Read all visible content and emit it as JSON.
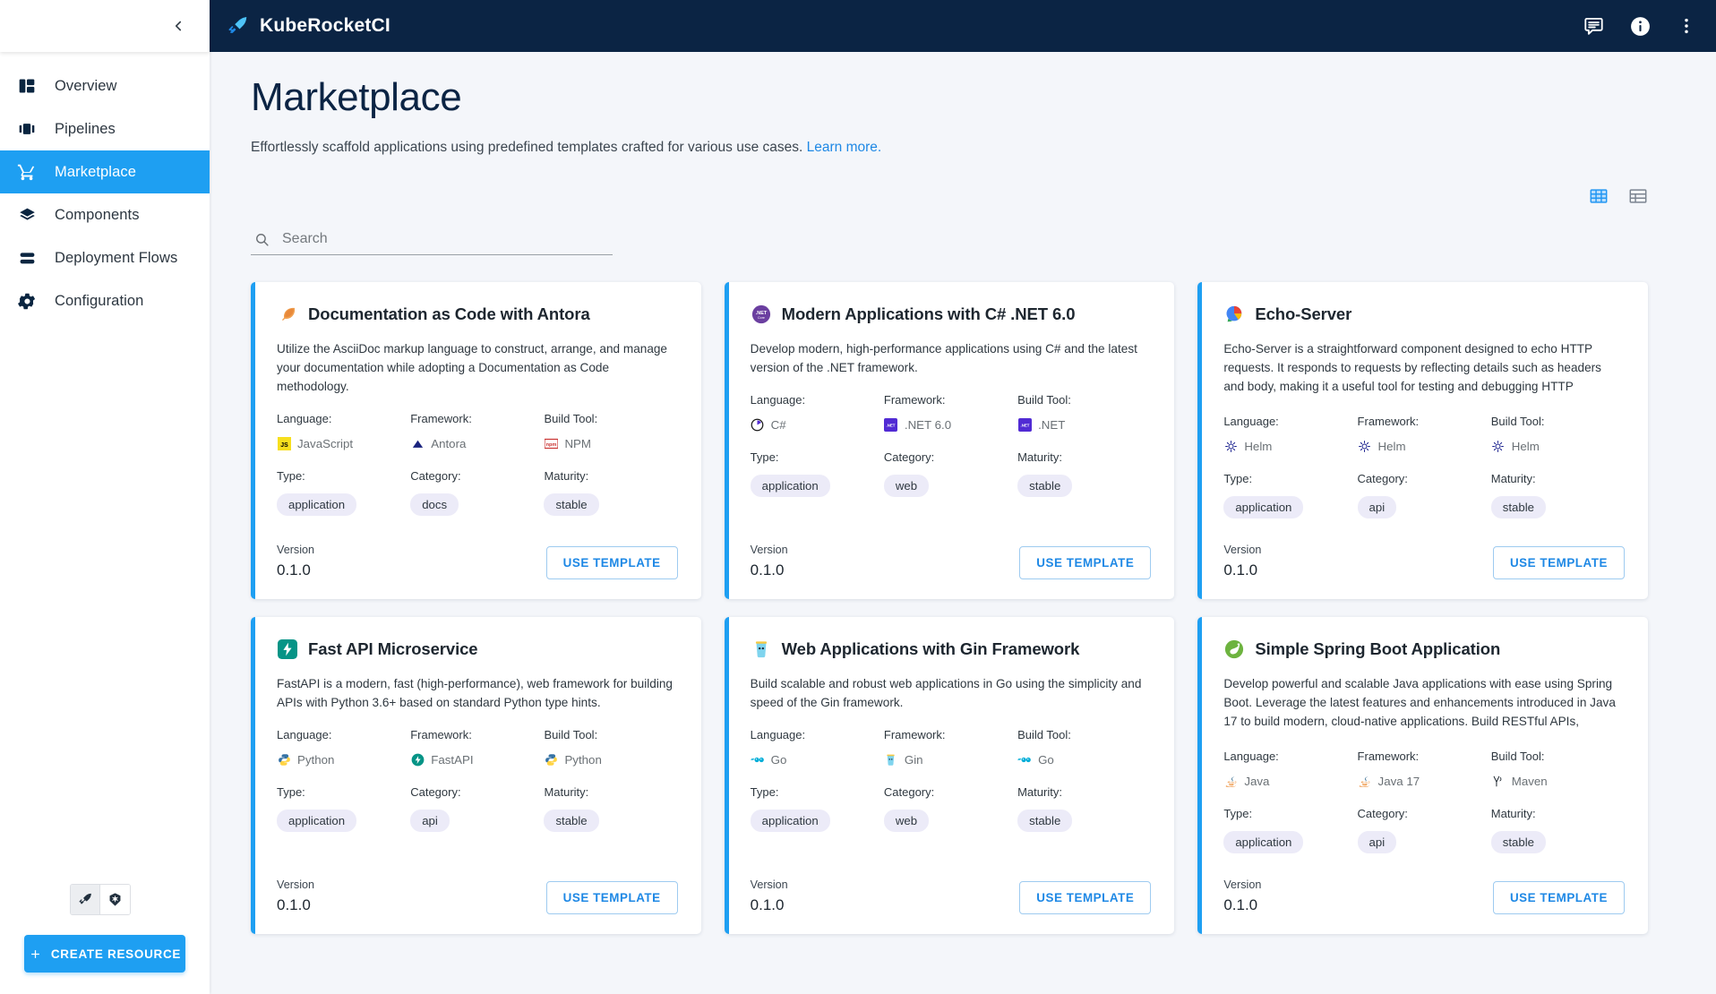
{
  "topbar": {
    "brand_name": "KubeRocketCI",
    "icons": [
      {
        "name": "chat-icon",
        "label": "Chat"
      },
      {
        "name": "info-icon",
        "label": "Info"
      },
      {
        "name": "kebab-menu-icon",
        "label": "More"
      }
    ]
  },
  "sidebar": {
    "collapse_label": "Collapse",
    "items": [
      {
        "label": "Overview",
        "icon": "dashboard-icon",
        "active": false
      },
      {
        "label": "Pipelines",
        "icon": "pipelines-icon",
        "active": false
      },
      {
        "label": "Marketplace",
        "icon": "cart-icon",
        "active": true
      },
      {
        "label": "Components",
        "icon": "layers-icon",
        "active": false
      },
      {
        "label": "Deployment Flows",
        "icon": "stack-icon",
        "active": false
      },
      {
        "label": "Configuration",
        "icon": "gear-icon",
        "active": false
      }
    ],
    "mode_toggle": [
      {
        "name": "kuberocket-mode-icon",
        "active": true
      },
      {
        "name": "kubernetes-mode-icon",
        "active": false
      }
    ],
    "create_button": "CREATE RESOURCE"
  },
  "page": {
    "title": "Marketplace",
    "subtitle": "Effortlessly scaffold applications using predefined templates crafted for various use cases.",
    "learn_more": "Learn more."
  },
  "view_toggle": [
    {
      "name": "grid-view-icon",
      "active": true
    },
    {
      "name": "table-view-icon",
      "active": false
    }
  ],
  "search": {
    "placeholder": "Search",
    "value": ""
  },
  "labels": {
    "language": "Language:",
    "framework": "Framework:",
    "build_tool": "Build Tool:",
    "type": "Type:",
    "category": "Category:",
    "maturity": "Maturity:",
    "version": "Version",
    "use_template": "USE TEMPLATE"
  },
  "colors": {
    "accent": "#1e9ff2",
    "topbar": "#0b2444",
    "chip_bg": "#ecebf8",
    "link": "#1e88e5"
  },
  "cards": [
    {
      "title": "Documentation as Code with Antora",
      "icon": "feather-icon",
      "icon_glyph": "🪶",
      "description": "Utilize the AsciiDoc markup language to construct, arrange, and manage your documentation while adopting a Documentation as Code methodology.",
      "language": "JavaScript",
      "language_icon": "javascript-icon",
      "framework": "Antora",
      "framework_icon": "antora-icon",
      "build_tool": "NPM",
      "build_tool_icon": "npm-icon",
      "type": "application",
      "category": "docs",
      "maturity": "stable",
      "version": "0.1.0"
    },
    {
      "title": "Modern Applications with C# .NET 6.0",
      "icon": "dotnet-icon",
      "icon_glyph": "",
      "description": "Develop modern, high-performance applications using C# and the latest version of the .NET framework.",
      "language": "C#",
      "language_icon": "csharp-icon",
      "framework": ".NET 6.0",
      "framework_icon": "dotnet-badge-icon",
      "build_tool": ".NET",
      "build_tool_icon": "dotnet-badge-icon",
      "type": "application",
      "category": "web",
      "maturity": "stable",
      "version": "0.1.0"
    },
    {
      "title": "Echo-Server",
      "icon": "echo-server-icon",
      "icon_glyph": "",
      "description": "Echo-Server is a straightforward component designed to echo HTTP requests. It responds to requests by reflecting details such as headers and body, making it a useful tool for testing and debugging HTTP interactions. Deploying Echo-Server provides an…",
      "language": "Helm",
      "language_icon": "helm-icon",
      "framework": "Helm",
      "framework_icon": "helm-icon",
      "build_tool": "Helm",
      "build_tool_icon": "helm-icon",
      "type": "application",
      "category": "api",
      "maturity": "stable",
      "version": "0.1.0"
    },
    {
      "title": "Fast API Microservice",
      "icon": "fastapi-icon",
      "icon_glyph": "",
      "description": "FastAPI is a modern, fast (high-performance), web framework for building APIs with Python 3.6+ based on standard Python type hints.",
      "language": "Python",
      "language_icon": "python-icon",
      "framework": "FastAPI",
      "framework_icon": "fastapi-icon",
      "build_tool": "Python",
      "build_tool_icon": "python-icon",
      "type": "application",
      "category": "api",
      "maturity": "stable",
      "version": "0.1.0"
    },
    {
      "title": "Web Applications with Gin Framework",
      "icon": "gin-icon",
      "icon_glyph": "🥤",
      "description": "Build scalable and robust web applications in Go using the simplicity and speed of the Gin framework.",
      "language": "Go",
      "language_icon": "go-icon",
      "framework": "Gin",
      "framework_icon": "gin-icon",
      "build_tool": "Go",
      "build_tool_icon": "go-icon",
      "type": "application",
      "category": "web",
      "maturity": "stable",
      "version": "0.1.0"
    },
    {
      "title": "Simple Spring Boot Application",
      "icon": "spring-icon",
      "icon_glyph": "",
      "description": "Develop powerful and scalable Java applications with ease using Spring Boot. Leverage the latest features and enhancements introduced in Java 17 to build modern, cloud-native applications. Build RESTful APIs, integrate with databases, implement security,…",
      "language": "Java",
      "language_icon": "java-icon",
      "framework": "Java 17",
      "framework_icon": "java-icon",
      "build_tool": "Maven",
      "build_tool_icon": "maven-icon",
      "type": "application",
      "category": "api",
      "maturity": "stable",
      "version": "0.1.0"
    }
  ]
}
